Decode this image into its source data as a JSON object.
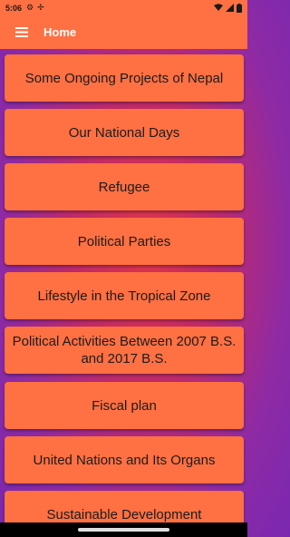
{
  "status_bar": {
    "time": "5:06",
    "icons": [
      "settings-icon",
      "fan-icon",
      "wifi-icon",
      "signal-icon",
      "battery-icon"
    ]
  },
  "app_bar": {
    "title": "Home",
    "menu_icon": "hamburger-menu-icon"
  },
  "colors": {
    "accent": "#ff7043",
    "background_start": "#e0354c",
    "background_end": "#7a28b0"
  },
  "topics": [
    "Some Ongoing Projects of Nepal",
    "Our National Days",
    "Refugee",
    "Political Parties",
    "Lifestyle in the Tropical Zone",
    "Political Activities Between 2007 B.S. and 2017 B.S.",
    "Fiscal plan",
    "United Nations and Its Organs",
    "Sustainable Development"
  ]
}
